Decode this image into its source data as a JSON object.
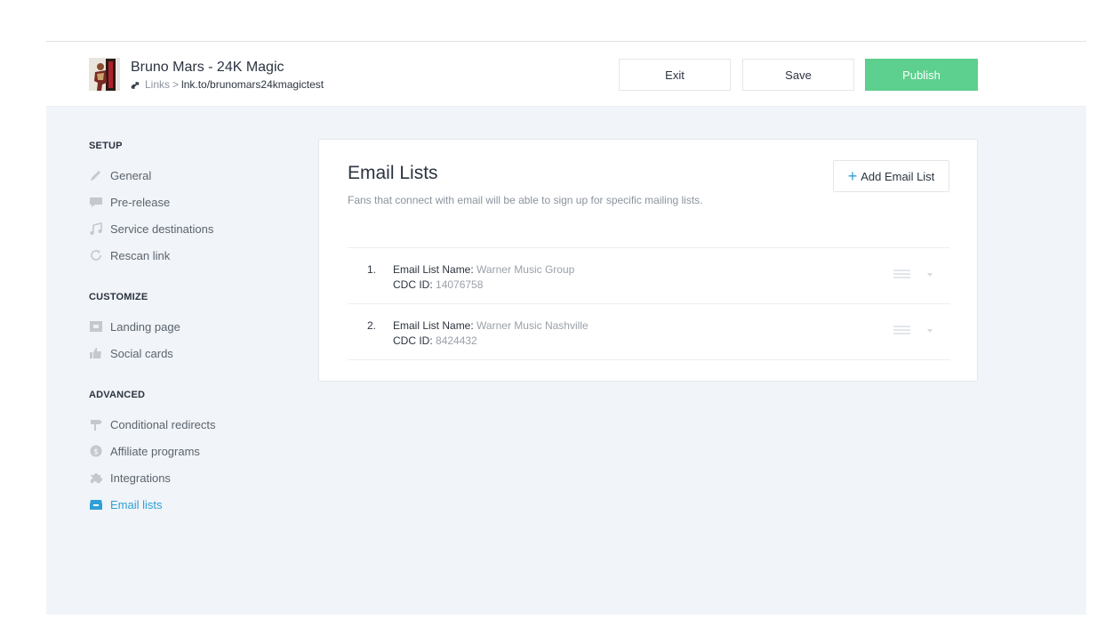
{
  "header": {
    "title": "Bruno Mars - 24K Magic",
    "breadcrumb_root": "Links",
    "breadcrumb_sep": ">",
    "breadcrumb_url": "lnk.to/brunomars24kmagictest",
    "exit_label": "Exit",
    "save_label": "Save",
    "publish_label": "Publish",
    "publish_color": "#5dcf8e"
  },
  "sidebar": {
    "setup_heading": "SETUP",
    "setup_items": [
      {
        "label": "General",
        "icon": "pencil-icon"
      },
      {
        "label": "Pre-release",
        "icon": "speech-bubble-icon"
      },
      {
        "label": "Service destinations",
        "icon": "music-note-icon"
      },
      {
        "label": "Rescan link",
        "icon": "refresh-icon"
      }
    ],
    "customize_heading": "CUSTOMIZE",
    "customize_items": [
      {
        "label": "Landing page",
        "icon": "landing-page-icon"
      },
      {
        "label": "Social cards",
        "icon": "thumbs-up-icon"
      }
    ],
    "advanced_heading": "ADVANCED",
    "advanced_items": [
      {
        "label": "Conditional redirects",
        "icon": "signpost-icon"
      },
      {
        "label": "Affiliate programs",
        "icon": "dollar-coin-icon"
      },
      {
        "label": "Integrations",
        "icon": "puzzle-icon"
      },
      {
        "label": "Email lists",
        "icon": "inbox-icon",
        "active": true
      }
    ],
    "active_color": "#2f9fd7"
  },
  "main": {
    "title": "Email Lists",
    "subtitle": "Fans that connect with email will be able to sign up for specific mailing lists.",
    "add_button_label": "Add Email List",
    "name_label": "Email List Name:",
    "cdc_label": "CDC ID:",
    "lists": [
      {
        "number": "1.",
        "name": "Warner Music Group",
        "cdc_id": "14076758"
      },
      {
        "number": "2.",
        "name": "Warner Music Nashville",
        "cdc_id": "8424432"
      }
    ]
  }
}
